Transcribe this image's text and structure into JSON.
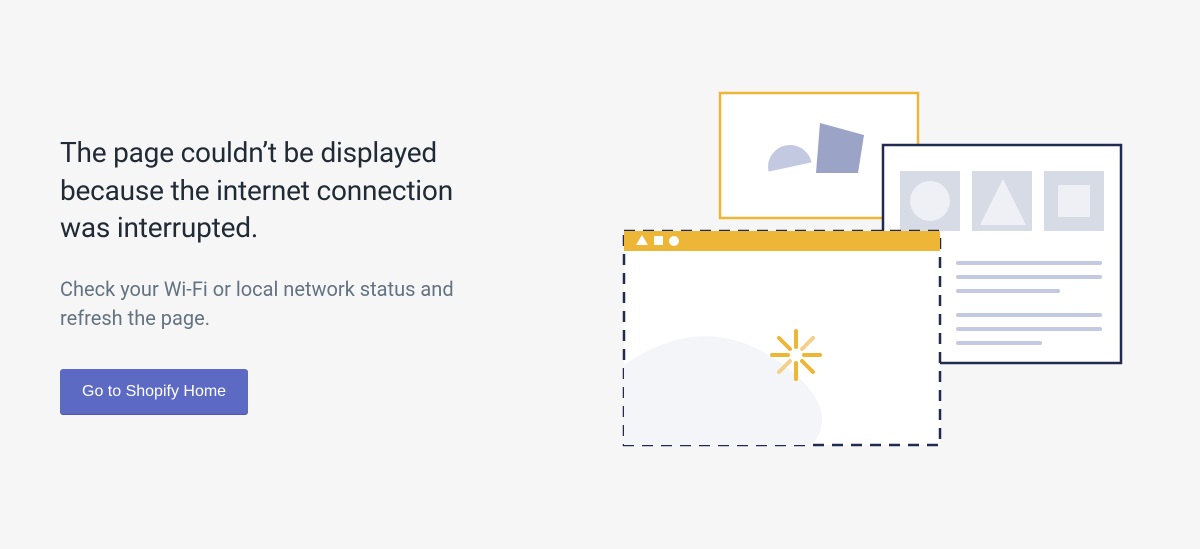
{
  "error": {
    "heading": "The page couldn’t be displayed because the internet connection was interrupted.",
    "subtext": "Check your Wi-Fi or local network status and refresh the page.",
    "button_label": "Go to Shopify Home"
  },
  "colors": {
    "background": "#f6f6f7",
    "heading": "#212b36",
    "subtext": "#637381",
    "button_bg": "#5c6ac4",
    "button_text": "#ffffff",
    "accent_yellow": "#eeb636",
    "navy": "#212b50",
    "light_gray": "#c4cdd5",
    "pale_blue": "#c2c9e0"
  }
}
